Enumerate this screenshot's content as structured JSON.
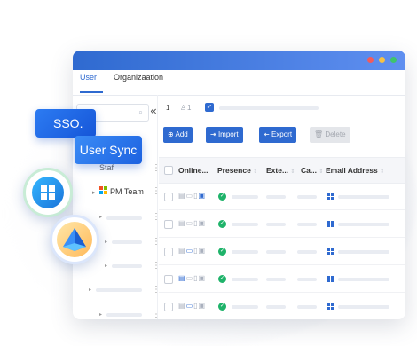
{
  "colors": {
    "accent": "#2f6ad0",
    "success": "#1fb36a",
    "dot_red": "#f25b5b",
    "dot_yellow": "#f6c244",
    "dot_green": "#3ec46d"
  },
  "tabs": [
    {
      "label": "User"
    },
    {
      "label": "Organizaation"
    }
  ],
  "left_panel": {
    "search_icon": "search-icon",
    "collapse_glyph": "«",
    "tree": [
      {
        "label": "Staf"
      },
      {
        "label": "PM Team"
      }
    ]
  },
  "toolbar": {
    "count": "1",
    "selected": "1",
    "buttons": [
      {
        "label": "Add",
        "icon": "⊕"
      },
      {
        "label": "Import",
        "icon": "⇥"
      },
      {
        "label": "Export",
        "icon": "⇤"
      },
      {
        "label": "Delete",
        "icon": "🗑"
      }
    ]
  },
  "table": {
    "columns": [
      {
        "label": "Online..."
      },
      {
        "label": "Presence"
      },
      {
        "label": "Exte..."
      },
      {
        "label": "Ca..."
      },
      {
        "label": "Email Address"
      }
    ],
    "rows": [
      {},
      {},
      {},
      {},
      {}
    ]
  },
  "overlays": {
    "sso_label": "SSO.",
    "user_sync_label": "User Sync"
  }
}
